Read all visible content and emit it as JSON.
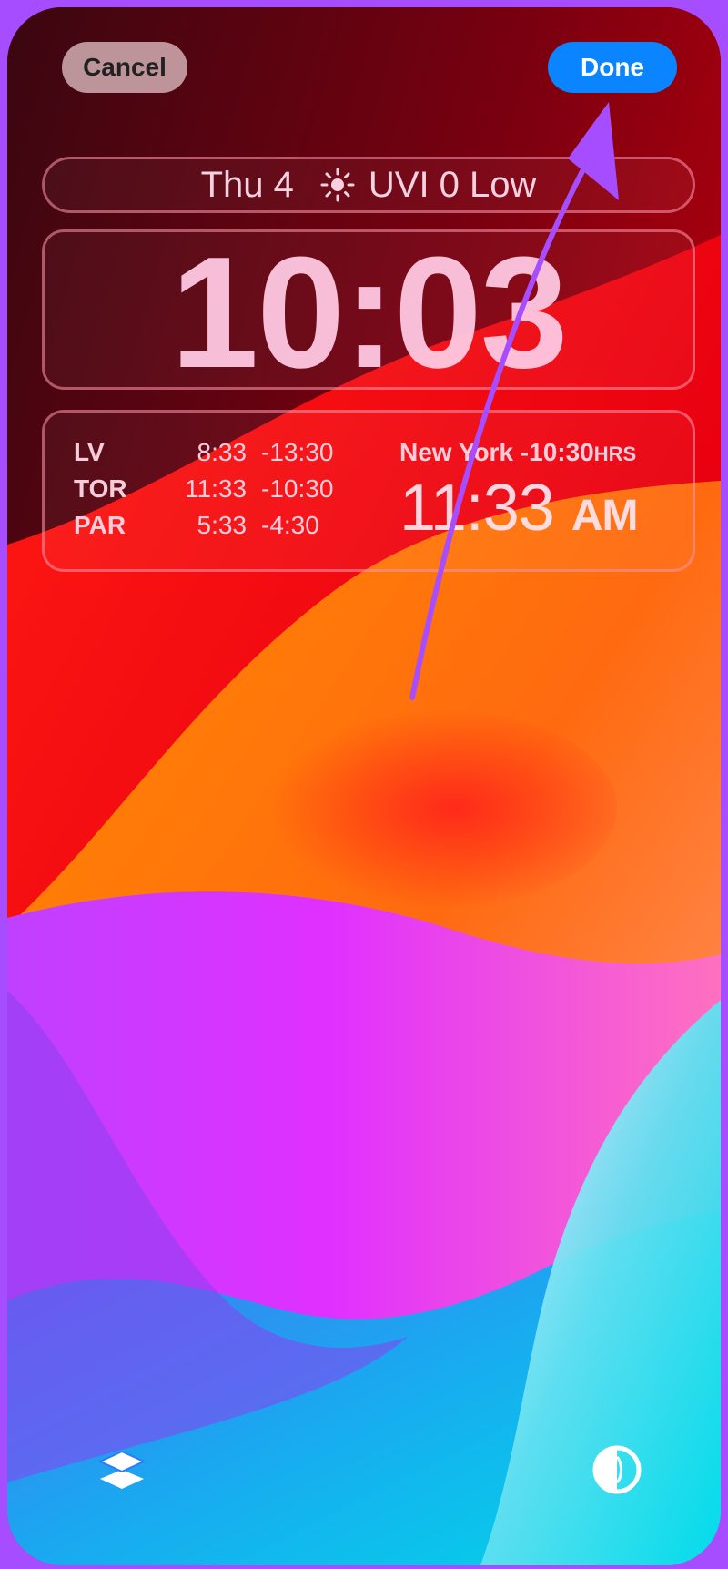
{
  "header": {
    "cancel_label": "Cancel",
    "done_label": "Done"
  },
  "widgets": {
    "date": {
      "day": "Thu 4",
      "weather_icon": "sun-icon",
      "uvi": "UVI 0 Low"
    },
    "time": "10:03",
    "world_clocks": [
      {
        "code": "LV",
        "time": "8:33",
        "offset": "-13:30"
      },
      {
        "code": "TOR",
        "time": "11:33",
        "offset": "-10:30"
      },
      {
        "code": "PAR",
        "time": "5:33",
        "offset": "-4:30"
      }
    ],
    "featured_city": {
      "label": "New York -10:30",
      "unit": "HRS",
      "time": "11:33",
      "ampm": "AM"
    }
  },
  "footer": {
    "left_icon": "layers-icon",
    "right_icon": "color-contrast-icon"
  },
  "colors": {
    "accent": "#0a84ff",
    "annotation": "#a64dff"
  }
}
